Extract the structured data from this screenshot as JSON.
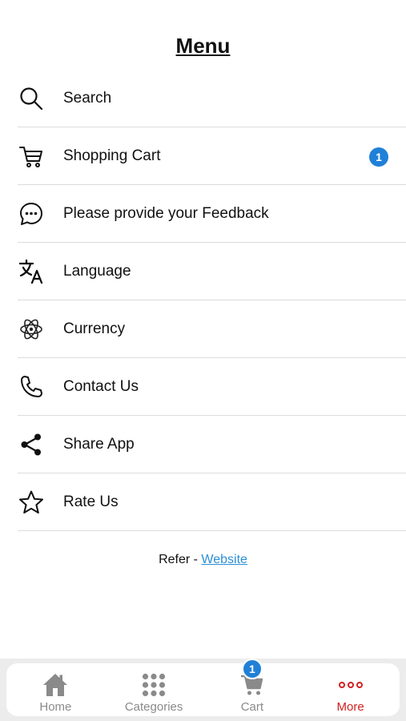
{
  "header": {
    "title": "Menu"
  },
  "menu": {
    "items": [
      {
        "label": "Search",
        "icon": "search-icon"
      },
      {
        "label": "Shopping Cart",
        "icon": "cart-icon",
        "badge": "1"
      },
      {
        "label": "Please provide your Feedback",
        "icon": "chat-bubble-icon"
      },
      {
        "label": "Language",
        "icon": "translate-icon"
      },
      {
        "label": "Currency",
        "icon": "atom-icon"
      },
      {
        "label": "Contact Us",
        "icon": "phone-icon"
      },
      {
        "label": "Share App",
        "icon": "share-icon"
      },
      {
        "label": "Rate Us",
        "icon": "star-icon"
      }
    ]
  },
  "footer": {
    "refer_prefix": "Refer - ",
    "refer_link": "Website"
  },
  "tabbar": {
    "tabs": [
      {
        "label": "Home",
        "icon": "home-icon"
      },
      {
        "label": "Categories",
        "icon": "grid-icon"
      },
      {
        "label": "Cart",
        "icon": "cart-icon",
        "badge": "1"
      },
      {
        "label": "More",
        "icon": "more-dots-icon",
        "active": true
      }
    ]
  },
  "colors": {
    "badge_blue": "#2080d8",
    "active_red": "#d32020",
    "link_blue": "#2a8fd6",
    "tab_gray": "#8a8a8a"
  }
}
